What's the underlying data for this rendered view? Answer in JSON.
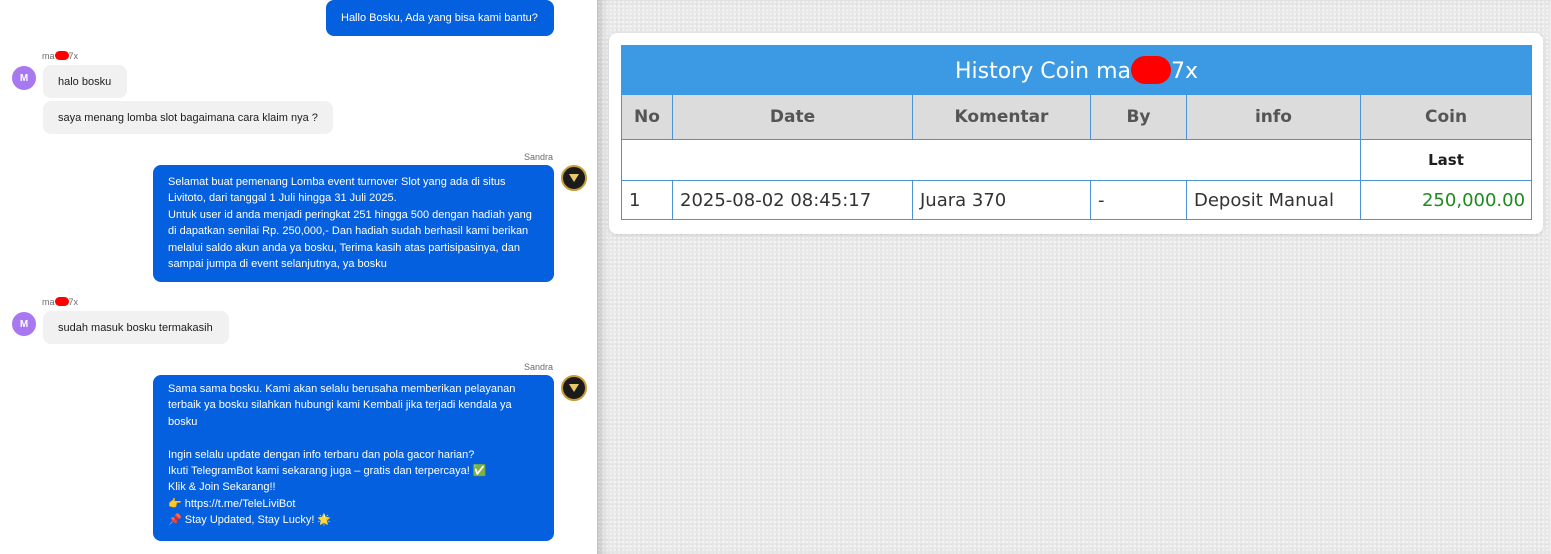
{
  "chat": {
    "messages": [
      {
        "id": "m1",
        "direction": "out",
        "text": "Hallo Bosku, Ada yang bisa kami bantu?"
      },
      {
        "id": "m2",
        "direction": "in",
        "sender": "ma 7x",
        "text": "halo bosku"
      },
      {
        "id": "m3",
        "direction": "in",
        "text": "saya menang lomba slot bagaimana cara klaim nya ?"
      },
      {
        "id": "m4",
        "direction": "out",
        "sender": "Sandra",
        "text": "Selamat buat pemenang Lomba event turnover Slot yang ada di situs\nLivitoto, dari tanggal 1 Juli hingga 31 Juli 2025.\nUntuk user id anda menjadi peringkat 251 hingga 500 dengan hadiah yang\ndi dapatkan senilai Rp. 250,000,- Dan hadiah sudah berhasil kami berikan\nmelalui saldo akun anda ya bosku, Terima kasih atas partisipasinya, dan\nsampai jumpa di event selanjutnya, ya bosku"
      },
      {
        "id": "m5",
        "direction": "in",
        "sender": "ma 7x",
        "text": "sudah masuk bosku termakasih"
      },
      {
        "id": "m6",
        "direction": "out",
        "sender": "Sandra",
        "text": "Sama sama bosku. Kami akan selalu berusaha memberikan pelayanan\nterbaik ya bosku silahkan hubungi kami Kembali jika terjadi kendala ya\nbosku\n\nIngin selalu update dengan info terbaru dan pola gacor harian?\nIkuti TelegramBot kami sekarang juga – gratis dan terpercaya! ✅\nKlik & Join Sekarang!!\n👉 https://t.me/TeleLiviBot\n📌 Stay Updated, Stay Lucky! 🌟"
      }
    ],
    "user_name_prefix": "ma",
    "user_name_suffix": "7x",
    "user_avatar_letter": "M",
    "agent_name": "Sandra"
  },
  "history": {
    "title_prefix": "History Coin ma",
    "title_suffix": "7x",
    "columns": [
      "No",
      "Date",
      "Komentar",
      "By",
      "info",
      "Coin"
    ],
    "last_label": "Last",
    "rows": [
      {
        "no": "1",
        "date": "2025-08-02 08:45:17",
        "komentar": "Juara 370",
        "by": "-",
        "info": "Deposit Manual",
        "coin": "250,000.00"
      }
    ]
  },
  "colors": {
    "outgoing_bubble": "#0560df",
    "incoming_bubble": "#f1f1f1",
    "table_header_blue": "#3b9ae3",
    "coin_green": "#1f8a1f",
    "redaction": "#ff0000"
  }
}
